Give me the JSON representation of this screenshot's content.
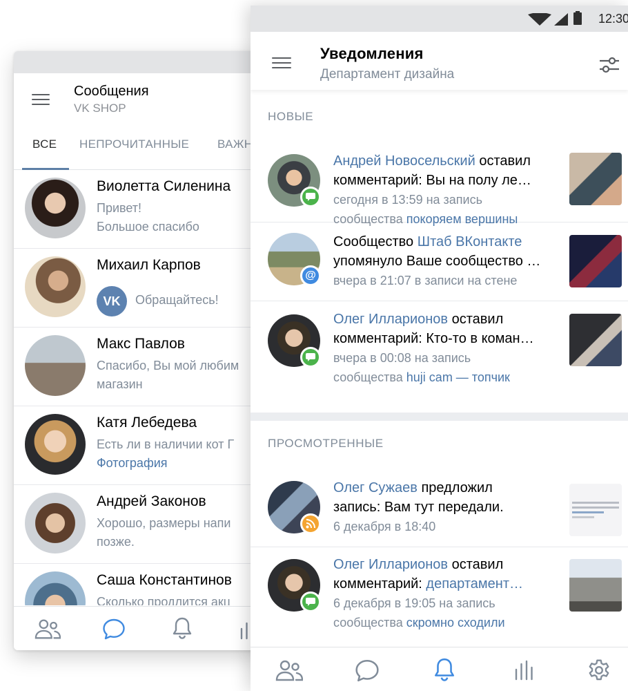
{
  "colors": {
    "accent": "#4a76a8",
    "active_nav": "#3f8ae0",
    "badge_comment": "#4bb34b",
    "badge_mention": "#3f8ae0",
    "badge_post": "#f4a431",
    "secondary_text": "#818c99"
  },
  "messages_screen": {
    "title": "Сообщения",
    "subtitle": "VK SHOP",
    "tabs": [
      "ВСЕ",
      "НЕПРОЧИТАННЫЕ",
      "ВАЖН"
    ],
    "active_tab": "ВСЕ",
    "dialogs": [
      {
        "name": "Виолетта Силенина",
        "line1": "Привет!",
        "line2": "Большое спасибо"
      },
      {
        "name": "Михаил Карпов",
        "badge": "vk-logo-icon",
        "line1": "Обращайтесь!"
      },
      {
        "name": "Макс Павлов",
        "line1": "Спасибо, Вы мой любим",
        "line2": "магазин"
      },
      {
        "name": "Катя Лебедева",
        "line1": "Есть ли в наличии кот Г",
        "line2": "Фотография",
        "line2_is_link": true
      },
      {
        "name": "Андрей Законов",
        "line1": "Хорошо, размеры напи",
        "line2": "позже."
      },
      {
        "name": "Саша Константинов",
        "line1": "Сколько продлится акц"
      }
    ],
    "nav": [
      "friends-icon",
      "messages-icon",
      "bell-icon",
      "stats-icon"
    ],
    "active_nav": "messages-icon"
  },
  "notifications_screen": {
    "status_time": "12:30",
    "title": "Уведомления",
    "subtitle": "Департамент дизайна",
    "filter_icon": "sliders-icon",
    "sections": [
      {
        "title": "НОВЫЕ",
        "items": [
          {
            "actor": "Андрей Новосельский",
            "action": " оставил",
            "line2": "комментарий: Вы на полу ле…",
            "meta1": "сегодня в 13:59 на запись",
            "meta2_prefix": "сообщества ",
            "meta2_link": "покоряем вершины",
            "badge": "comment-icon",
            "badge_color": "green"
          },
          {
            "pre": "Сообщество ",
            "actor": "Штаб ВКонтакте",
            "line2": "упомянуло Ваше сообщество …",
            "meta1": "вчера в 21:07 в записи на стене",
            "badge": "mention-icon",
            "badge_color": "blue"
          },
          {
            "actor": "Олег Илларионов",
            "action": " оставил",
            "line2": "комментарий: Кто-то в коман…",
            "meta1": "вчера в 00:08 на запись",
            "meta2_prefix": "сообщества ",
            "meta2_link": "huji cam — топчик",
            "badge": "comment-icon",
            "badge_color": "green"
          }
        ]
      },
      {
        "title": "ПРОСМОТРЕННЫЕ",
        "items": [
          {
            "actor": "Олег Сужаев",
            "action": " предложил",
            "line2": "запись: Вам тут передали.",
            "meta1": "6 декабря в 18:40",
            "badge": "rss-icon",
            "badge_color": "orange"
          },
          {
            "actor": "Олег Илларионов",
            "action": " оставил",
            "line2_prefix": "комментарий: ",
            "line2_link": "департамент…",
            "meta1": "6 декабря в 19:05 на запись",
            "meta2_prefix": "сообщества ",
            "meta2_link": "скромно сходили",
            "badge": "comment-icon",
            "badge_color": "green"
          }
        ]
      }
    ],
    "nav": [
      "friends-icon",
      "messages-icon",
      "bell-icon",
      "stats-icon",
      "gear-icon"
    ],
    "active_nav": "bell-icon"
  }
}
